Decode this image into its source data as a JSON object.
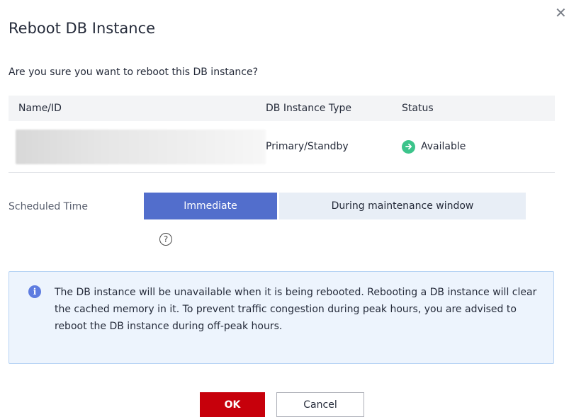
{
  "dialog": {
    "title": "Reboot DB Instance",
    "confirm_text": "Are you sure you want to reboot this DB instance?",
    "close_icon": "close-icon"
  },
  "table": {
    "headers": [
      "Name/ID",
      "DB Instance Type",
      "Status"
    ],
    "rows": [
      {
        "name_id": "",
        "type": "Primary/Standby",
        "status": "Available"
      }
    ]
  },
  "schedule": {
    "label": "Scheduled Time",
    "options": [
      "Immediate",
      "During maintenance window"
    ],
    "selected": "Immediate",
    "help_icon": "help-icon"
  },
  "notice": {
    "icon": "info-icon",
    "text": "The DB instance will be unavailable when it is being rebooted. Rebooting a DB instance will clear the cached memory in it. To prevent traffic congestion during peak hours, you are advised to reboot the DB instance during off-peak hours."
  },
  "buttons": {
    "ok": "OK",
    "cancel": "Cancel"
  },
  "colors": {
    "primary": "#526ecc",
    "danger": "#c7000b",
    "status_available": "#3cc48b",
    "notice_bg": "#edf4fd"
  }
}
